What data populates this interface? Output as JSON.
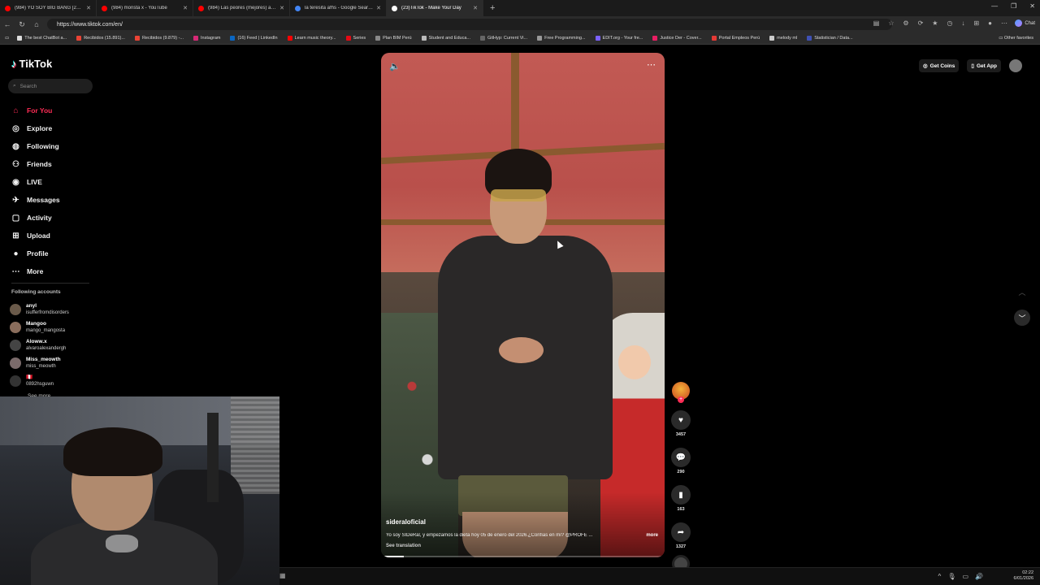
{
  "browser": {
    "tabs": [
      {
        "label": "(984) YO SOY BIG BANG [20/08/1...",
        "color": "#ff0000"
      },
      {
        "label": "(984) monsta x - YouTube",
        "color": "#ff0000"
      },
      {
        "label": "(984) Las peores (mejores) audicio...",
        "color": "#ff0000"
      },
      {
        "label": "la teresita afhs - Google Search",
        "color": "#4285f4"
      },
      {
        "label": "(23)TikTok - Make Your Day",
        "color": "#ffffff"
      }
    ],
    "url": "https://www.tiktok.com/en/",
    "chat_label": "Chat",
    "bookmarks": [
      "The best ChatBot a...",
      "Recibidos (15.891)...",
      "Recibidos (9.879) -...",
      "Instagram",
      "(16) Feed | LinkedIn",
      "Learn music theory...",
      "Series",
      "Plan BIM Perú",
      "Student and Educa...",
      "GitHyp: Current Vi...",
      "Free Programming...",
      "EDIT.org - Your fre...",
      "Justice Der - Cover...",
      "Portal Empleos Perú",
      "melody ml",
      "Statistician / Data..."
    ],
    "other_favorites": "Other favorites"
  },
  "tiktok": {
    "logo": "TikTok",
    "search_placeholder": "Search",
    "nav": [
      {
        "label": "For You",
        "icon": "home-icon"
      },
      {
        "label": "Explore",
        "icon": "compass-icon"
      },
      {
        "label": "Following",
        "icon": "following-icon"
      },
      {
        "label": "Friends",
        "icon": "friends-icon"
      },
      {
        "label": "LIVE",
        "icon": "live-icon"
      },
      {
        "label": "Messages",
        "icon": "messages-icon"
      },
      {
        "label": "Activity",
        "icon": "activity-icon"
      },
      {
        "label": "Upload",
        "icon": "upload-icon"
      },
      {
        "label": "Profile",
        "icon": "profile-icon"
      },
      {
        "label": "More",
        "icon": "more-icon"
      }
    ],
    "following_title": "Following accounts",
    "following": [
      {
        "name": "anyl",
        "user": "isufferfromdisorders"
      },
      {
        "name": "Mangoo",
        "user": "mango_mangosta"
      },
      {
        "name": "Aloww.x",
        "user": "alvaroalexandergh"
      },
      {
        "name": "Miss_meowth",
        "user": "miss_meowth"
      },
      {
        "name": "🇵🇪",
        "user": "0892hsguwn"
      }
    ],
    "see_more": "See more",
    "get_coins": "Get Coins",
    "get_app": "Get App"
  },
  "video": {
    "author": "sideraloficial",
    "caption": "Yo soy SIDeRal, y empezamos la dieta hoy 05 de enero del 2026.¿Confías en mí? @PROFE ...",
    "caption_more": "more",
    "see_translation": "See translation",
    "likes": "3457",
    "comments": "290",
    "saves": "163",
    "shares": "1327"
  },
  "taskbar": {
    "time": "02:22",
    "date": "6/01/2026"
  }
}
